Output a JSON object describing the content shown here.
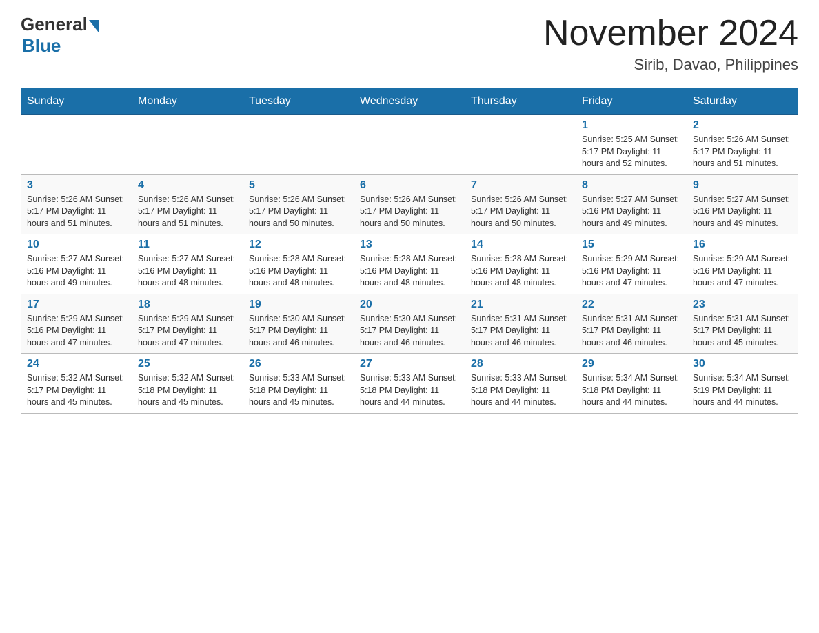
{
  "header": {
    "logo_general": "General",
    "logo_blue": "Blue",
    "month_title": "November 2024",
    "location": "Sirib, Davao, Philippines"
  },
  "days_of_week": [
    "Sunday",
    "Monday",
    "Tuesday",
    "Wednesday",
    "Thursday",
    "Friday",
    "Saturday"
  ],
  "weeks": [
    [
      {
        "day": "",
        "info": ""
      },
      {
        "day": "",
        "info": ""
      },
      {
        "day": "",
        "info": ""
      },
      {
        "day": "",
        "info": ""
      },
      {
        "day": "",
        "info": ""
      },
      {
        "day": "1",
        "info": "Sunrise: 5:25 AM\nSunset: 5:17 PM\nDaylight: 11 hours and 52 minutes."
      },
      {
        "day": "2",
        "info": "Sunrise: 5:26 AM\nSunset: 5:17 PM\nDaylight: 11 hours and 51 minutes."
      }
    ],
    [
      {
        "day": "3",
        "info": "Sunrise: 5:26 AM\nSunset: 5:17 PM\nDaylight: 11 hours and 51 minutes."
      },
      {
        "day": "4",
        "info": "Sunrise: 5:26 AM\nSunset: 5:17 PM\nDaylight: 11 hours and 51 minutes."
      },
      {
        "day": "5",
        "info": "Sunrise: 5:26 AM\nSunset: 5:17 PM\nDaylight: 11 hours and 50 minutes."
      },
      {
        "day": "6",
        "info": "Sunrise: 5:26 AM\nSunset: 5:17 PM\nDaylight: 11 hours and 50 minutes."
      },
      {
        "day": "7",
        "info": "Sunrise: 5:26 AM\nSunset: 5:17 PM\nDaylight: 11 hours and 50 minutes."
      },
      {
        "day": "8",
        "info": "Sunrise: 5:27 AM\nSunset: 5:16 PM\nDaylight: 11 hours and 49 minutes."
      },
      {
        "day": "9",
        "info": "Sunrise: 5:27 AM\nSunset: 5:16 PM\nDaylight: 11 hours and 49 minutes."
      }
    ],
    [
      {
        "day": "10",
        "info": "Sunrise: 5:27 AM\nSunset: 5:16 PM\nDaylight: 11 hours and 49 minutes."
      },
      {
        "day": "11",
        "info": "Sunrise: 5:27 AM\nSunset: 5:16 PM\nDaylight: 11 hours and 48 minutes."
      },
      {
        "day": "12",
        "info": "Sunrise: 5:28 AM\nSunset: 5:16 PM\nDaylight: 11 hours and 48 minutes."
      },
      {
        "day": "13",
        "info": "Sunrise: 5:28 AM\nSunset: 5:16 PM\nDaylight: 11 hours and 48 minutes."
      },
      {
        "day": "14",
        "info": "Sunrise: 5:28 AM\nSunset: 5:16 PM\nDaylight: 11 hours and 48 minutes."
      },
      {
        "day": "15",
        "info": "Sunrise: 5:29 AM\nSunset: 5:16 PM\nDaylight: 11 hours and 47 minutes."
      },
      {
        "day": "16",
        "info": "Sunrise: 5:29 AM\nSunset: 5:16 PM\nDaylight: 11 hours and 47 minutes."
      }
    ],
    [
      {
        "day": "17",
        "info": "Sunrise: 5:29 AM\nSunset: 5:16 PM\nDaylight: 11 hours and 47 minutes."
      },
      {
        "day": "18",
        "info": "Sunrise: 5:29 AM\nSunset: 5:17 PM\nDaylight: 11 hours and 47 minutes."
      },
      {
        "day": "19",
        "info": "Sunrise: 5:30 AM\nSunset: 5:17 PM\nDaylight: 11 hours and 46 minutes."
      },
      {
        "day": "20",
        "info": "Sunrise: 5:30 AM\nSunset: 5:17 PM\nDaylight: 11 hours and 46 minutes."
      },
      {
        "day": "21",
        "info": "Sunrise: 5:31 AM\nSunset: 5:17 PM\nDaylight: 11 hours and 46 minutes."
      },
      {
        "day": "22",
        "info": "Sunrise: 5:31 AM\nSunset: 5:17 PM\nDaylight: 11 hours and 46 minutes."
      },
      {
        "day": "23",
        "info": "Sunrise: 5:31 AM\nSunset: 5:17 PM\nDaylight: 11 hours and 45 minutes."
      }
    ],
    [
      {
        "day": "24",
        "info": "Sunrise: 5:32 AM\nSunset: 5:17 PM\nDaylight: 11 hours and 45 minutes."
      },
      {
        "day": "25",
        "info": "Sunrise: 5:32 AM\nSunset: 5:18 PM\nDaylight: 11 hours and 45 minutes."
      },
      {
        "day": "26",
        "info": "Sunrise: 5:33 AM\nSunset: 5:18 PM\nDaylight: 11 hours and 45 minutes."
      },
      {
        "day": "27",
        "info": "Sunrise: 5:33 AM\nSunset: 5:18 PM\nDaylight: 11 hours and 44 minutes."
      },
      {
        "day": "28",
        "info": "Sunrise: 5:33 AM\nSunset: 5:18 PM\nDaylight: 11 hours and 44 minutes."
      },
      {
        "day": "29",
        "info": "Sunrise: 5:34 AM\nSunset: 5:18 PM\nDaylight: 11 hours and 44 minutes."
      },
      {
        "day": "30",
        "info": "Sunrise: 5:34 AM\nSunset: 5:19 PM\nDaylight: 11 hours and 44 minutes."
      }
    ]
  ]
}
